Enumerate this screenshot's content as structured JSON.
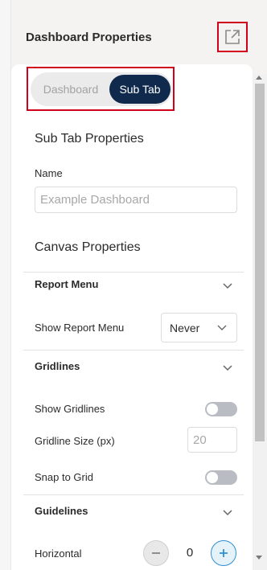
{
  "header": {
    "title": "Dashboard Properties",
    "popout_icon": "external-link-icon"
  },
  "tabs": {
    "items": [
      "Dashboard",
      "Sub Tab"
    ],
    "active": "Sub Tab"
  },
  "sub_tab_properties": {
    "heading": "Sub Tab Properties",
    "name_label": "Name",
    "name_placeholder": "Example Dashboard"
  },
  "canvas_properties": {
    "heading": "Canvas Properties"
  },
  "report_menu": {
    "title": "Report Menu",
    "show_label": "Show Report Menu",
    "show_value": "Never"
  },
  "gridlines": {
    "title": "Gridlines",
    "show_label": "Show Gridlines",
    "show_enabled": false,
    "size_label": "Gridline Size (px)",
    "size_placeholder": "20",
    "snap_label": "Snap to Grid",
    "snap_enabled": false
  },
  "guidelines": {
    "title": "Guidelines",
    "horizontal_label": "Horizontal",
    "horizontal_value": "0"
  },
  "colors": {
    "accent": "#0f2a4d",
    "highlight": "#d0021b",
    "plus": "#2f8fd1"
  }
}
